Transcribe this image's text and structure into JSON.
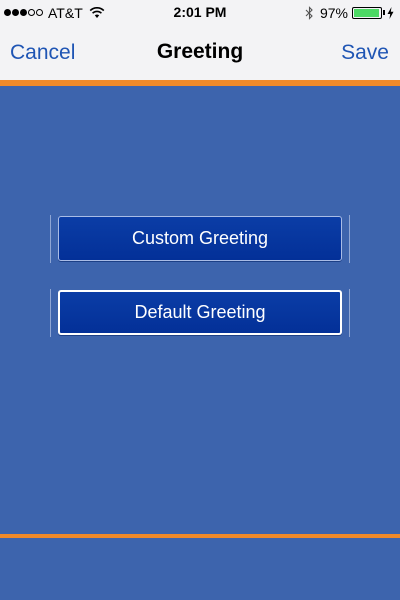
{
  "status_bar": {
    "carrier": "AT&T",
    "time": "2:01 PM",
    "battery_percent": "97%",
    "battery_level": 0.97,
    "signal_bars": 3,
    "signal_max": 5,
    "icons": [
      "wifi-icon",
      "bluetooth-icon",
      "battery-icon",
      "charging-bolt-icon"
    ]
  },
  "nav": {
    "cancel_label": "Cancel",
    "title": "Greeting",
    "save_label": "Save"
  },
  "options": {
    "custom_label": "Custom Greeting",
    "default_label": "Default Greeting",
    "selected": "default"
  },
  "colors": {
    "background": "#3d64ad",
    "accent_orange": "#f08a2a",
    "button_blue": "#03349c",
    "link_blue": "#1f55b4",
    "battery_green": "#4cd964"
  }
}
